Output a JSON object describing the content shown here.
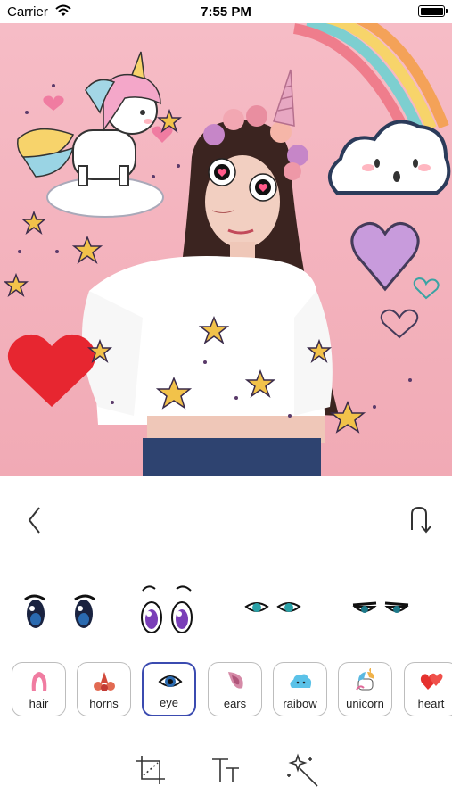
{
  "status_bar": {
    "carrier": "Carrier",
    "time": "7:55 PM"
  },
  "canvas": {
    "background_color": "#f3b3bd"
  },
  "nav": {
    "back_icon": "chevron-left-icon",
    "undo_icon": "undo-arrow-icon"
  },
  "sticker_options": [
    {
      "name": "anime-eyes-dark",
      "selected": false
    },
    {
      "name": "anime-eyes-purple",
      "selected": false
    },
    {
      "name": "anime-eyes-teal",
      "selected": false
    },
    {
      "name": "anime-eyes-narrow",
      "selected": false
    }
  ],
  "categories": [
    {
      "label": "hair",
      "icon": "hair-icon",
      "selected": false
    },
    {
      "label": "horns",
      "icon": "horns-icon",
      "selected": false
    },
    {
      "label": "eye",
      "icon": "eye-icon",
      "selected": true
    },
    {
      "label": "ears",
      "icon": "ears-icon",
      "selected": false
    },
    {
      "label": "raibow",
      "icon": "cloud-icon",
      "selected": false
    },
    {
      "label": "unicorn",
      "icon": "unicorn-icon",
      "selected": false
    },
    {
      "label": "heart",
      "icon": "heart-icon",
      "selected": false
    }
  ],
  "tools": [
    {
      "name": "crop-tool",
      "icon": "crop-icon"
    },
    {
      "name": "text-tool",
      "icon": "text-icon"
    },
    {
      "name": "magic-wand-tool",
      "icon": "magic-wand-icon"
    }
  ],
  "colors": {
    "accent": "#3b4bb0",
    "border": "#bdbdbd"
  }
}
